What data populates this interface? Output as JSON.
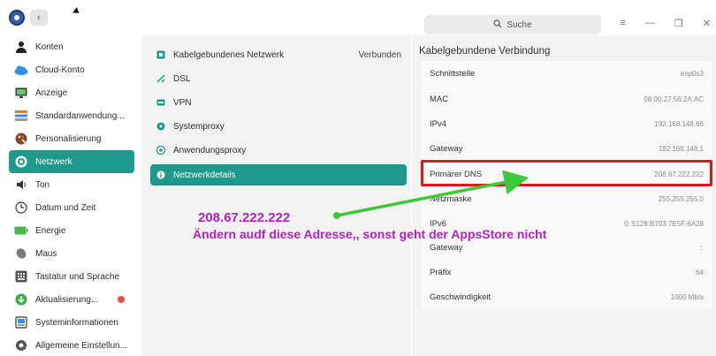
{
  "header": {
    "search_placeholder": "Suche",
    "back_glyph": "‹",
    "window_buttons": [
      "≡",
      "—",
      "❐",
      "✕"
    ]
  },
  "sidebar": {
    "items": [
      {
        "label": "Konten",
        "icon": "user-icon"
      },
      {
        "label": "Cloud-Konto",
        "icon": "cloud-icon"
      },
      {
        "label": "Anzeige",
        "icon": "monitor-icon"
      },
      {
        "label": "Standardanwendung...",
        "icon": "default-apps-icon"
      },
      {
        "label": "Personalisierung",
        "icon": "palette-icon"
      },
      {
        "label": "Netzwerk",
        "icon": "network-icon",
        "active": true
      },
      {
        "label": "Ton",
        "icon": "speaker-icon"
      },
      {
        "label": "Datum und Zeit",
        "icon": "clock-icon"
      },
      {
        "label": "Energie",
        "icon": "battery-icon"
      },
      {
        "label": "Maus",
        "icon": "mouse-icon"
      },
      {
        "label": "Tastatur und Sprache",
        "icon": "keyboard-icon"
      },
      {
        "label": "Aktualisierung...",
        "icon": "update-icon",
        "badge": true
      },
      {
        "label": "Systeminformationen",
        "icon": "system-info-icon"
      },
      {
        "label": "Allgemeine Einstellun...",
        "icon": "general-settings-icon"
      }
    ]
  },
  "network": {
    "items": [
      {
        "label": "Kabelgebundenes Netzwerk",
        "status": "Verbunden",
        "icon": "wired-network-icon"
      },
      {
        "label": "DSL",
        "icon": "dsl-icon"
      },
      {
        "label": "VPN",
        "icon": "vpn-icon"
      },
      {
        "label": "Systemproxy",
        "icon": "system-proxy-icon"
      },
      {
        "label": "Anwendungsproxy",
        "icon": "app-proxy-icon"
      },
      {
        "label": "Netzwerkdetails",
        "icon": "info-icon",
        "active": true
      }
    ]
  },
  "details": {
    "title": "Kabelgebundene Verbindung",
    "rows": [
      {
        "label": "Schnittstelle",
        "value": "enp0s3"
      },
      {
        "label": "MAC",
        "value": "08:00:27:56:2A:AC"
      },
      {
        "label": "IPv4",
        "value": "192.168.148.66"
      },
      {
        "label": "Gateway",
        "value": "192.168.148.1"
      },
      {
        "label": "Primärer DNS",
        "value": "208.67.222.222"
      },
      {
        "label": "Netzmaske",
        "value": "255.255.255.0"
      },
      {
        "label": "IPv6",
        "value": "0::5128:B703:7E5F:6A28"
      },
      {
        "label": "Gateway",
        "value": "::"
      },
      {
        "label": "Präfix",
        "value": "64"
      },
      {
        "label": "Geschwindigkeit",
        "value": "1000 Mb/s"
      }
    ]
  },
  "annotation": {
    "ip": "208.67.222.222",
    "message": "Ändern audf diese Adresse,, sonst geht der AppsStore nicht",
    "text_color": "#b620c9",
    "arrow_color": "#3ec93a",
    "box_color": "#d81b1b"
  },
  "colors": {
    "accent": "#1e9a8c"
  }
}
